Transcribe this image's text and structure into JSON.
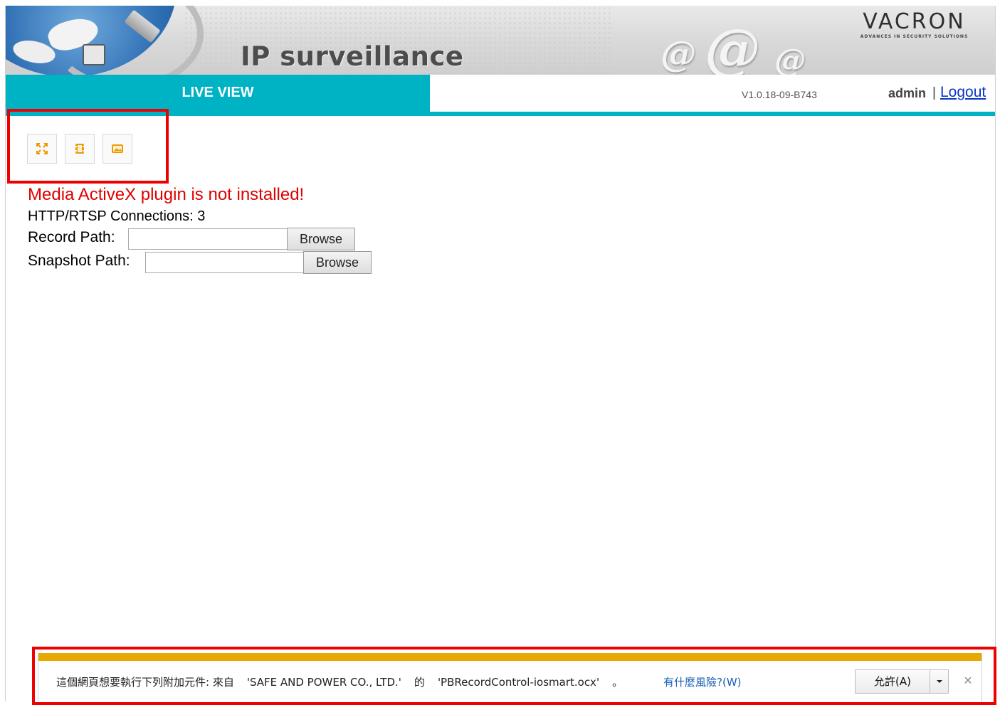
{
  "header": {
    "title": "IP surveillance",
    "brand": "VACRON",
    "brand_tagline": "ADVANCES IN SECURITY SOLUTIONS"
  },
  "nav": {
    "active_tab": "LIVE VIEW",
    "version": "V1.0.18-09-B743",
    "user": "admin",
    "separator": "|",
    "logout_label": "Logout"
  },
  "toolbar": {
    "buttons": [
      {
        "icon": "fullscreen-icon"
      },
      {
        "icon": "record-icon"
      },
      {
        "icon": "snapshot-icon"
      }
    ]
  },
  "status": {
    "error": "Media ActiveX plugin is not installed!",
    "connections": "HTTP/RTSP Connections: 3"
  },
  "paths": {
    "record_label": "Record Path:",
    "record_value": "",
    "snapshot_label": "Snapshot Path:",
    "snapshot_value": "",
    "browse_label": "Browse"
  },
  "infobar": {
    "message": "這個網頁想要執行下列附加元件: 來自",
    "publisher": "'SAFE AND POWER CO., LTD.'",
    "of": "的",
    "addon": "'PBRecordControl-iosmart.ocx'",
    "dot": "。",
    "risk_link": "有什麼風險?(W)",
    "allow_label": "允許(A)",
    "close_label": "×"
  },
  "colors": {
    "accent": "#00b3c4",
    "error": "#e00000",
    "highlight": "#ee0000",
    "infobar_top": "#e7a800",
    "link": "#0a36c8",
    "icon": "#f09a00"
  }
}
